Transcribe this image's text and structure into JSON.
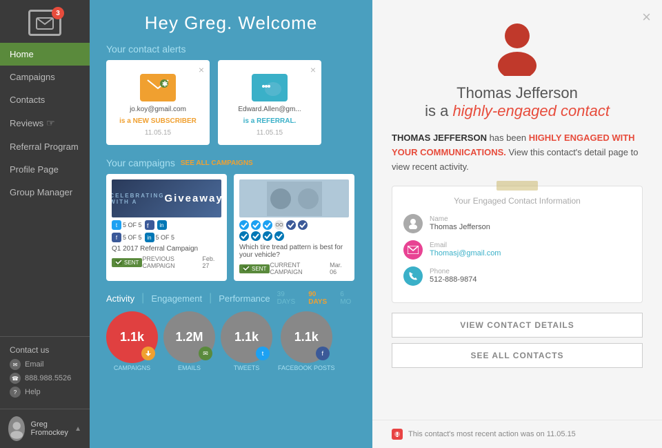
{
  "sidebar": {
    "logo_badge": "3",
    "nav_items": [
      {
        "label": "Home",
        "active": true
      },
      {
        "label": "Campaigns",
        "active": false
      },
      {
        "label": "Contacts",
        "active": false
      },
      {
        "label": "Reviews",
        "active": false
      },
      {
        "label": "Referral Program",
        "active": false
      },
      {
        "label": "Profile Page",
        "active": false
      },
      {
        "label": "Group Manager",
        "active": false
      }
    ],
    "contact_title": "Contact us",
    "contact_email": "Email",
    "contact_phone": "888.988.5526",
    "contact_help": "Help",
    "user_name": "Greg Fromockey"
  },
  "main": {
    "welcome": "Hey Greg. Welcome",
    "contact_alerts_label": "Your contact alerts",
    "alert1_email": "jo.koy@gmail.com",
    "alert1_status": "is a NEW SUBSCRIBER",
    "alert1_date": "11.05.15",
    "alert2_email": "Edward.Allen@gm...",
    "alert2_status": "is a REFERRAL.",
    "alert2_date": "11.05.15",
    "campaigns_label": "Your campaigns",
    "see_all": "SEE ALL CAMPAIGNS",
    "campaign1_name": "Q1 2017 Referral Campaign",
    "campaign1_label": "PREVIOUS CAMPAIGN",
    "campaign1_date": "Feb. 27",
    "campaign1_img": "Giveaway",
    "campaign2_name": "Which tire tread pattern is best for your vehicle?",
    "campaign2_label": "CURRENT CAMPAIGN",
    "campaign2_date": "Mar. 06",
    "campaign_stat": "5 OF 5",
    "activity_tab": "Activity",
    "engagement_tab": "Engagement",
    "performance_tab": "Performance",
    "filter_39": "39 DAYS",
    "filter_90": "90 DAYS",
    "filter_6mo": "6 MO",
    "metric_campaigns_val": "1.1k",
    "metric_campaigns_label": "CAMPAIGNS",
    "metric_emails_val": "1.2M",
    "metric_emails_label": "EMAILS",
    "metric_tweets_val": "1.1k",
    "metric_tweets_label": "TWEETS",
    "metric_fb_val": "1.1k",
    "metric_fb_label": "FACEBOOK POSTS"
  },
  "panel": {
    "close_label": "×",
    "contact_name": "Thomas Jefferson",
    "engaged_prefix": "is a",
    "engaged_label": "highly-engaged contact",
    "desc_name": "THOMAS JEFFERSON",
    "desc_highlight": "HIGHLY ENGAGED WITH YOUR COMMUNICATIONS.",
    "desc_rest": " View this contact's detail page to view recent activity.",
    "card_title": "Your Engaged Contact Information",
    "name_label": "Name",
    "name_value": "Thomas Jefferson",
    "email_label": "Email",
    "email_value": "Thomasj@gmail.com",
    "phone_label": "Phone",
    "phone_value": "512-888-9874",
    "btn_view": "VIEW CONTACT DETAILS",
    "btn_all": "SEE ALL CONTACTS",
    "footer_text": "This contact's most recent action was on 11.05.15"
  }
}
